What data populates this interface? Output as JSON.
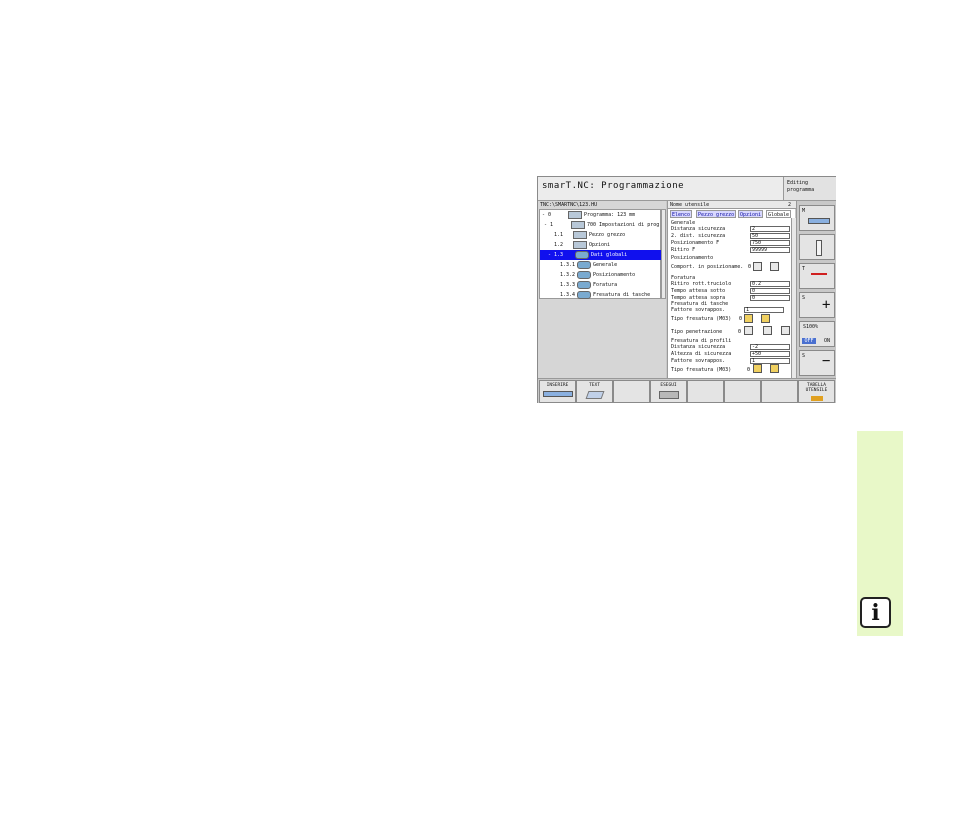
{
  "header": {
    "title": "smarT.NC: Programmazione",
    "mode": [
      "Editing",
      "programma"
    ]
  },
  "tree": {
    "path": "TNC:\\SMARTNC\\123.HU",
    "items": [
      {
        "num": "- 0",
        "label": "Programma: 123 mm",
        "selected": false
      },
      {
        "num": "- 1",
        "label": "700 Impostazioni di prog",
        "selected": false
      },
      {
        "num": "1.1",
        "label": "Pezzo grezzo",
        "selected": false
      },
      {
        "num": "1.2",
        "label": "Opzioni",
        "selected": false
      },
      {
        "num": "- 1.3",
        "label": "Dati globali",
        "selected": true
      },
      {
        "num": "1.3.1",
        "label": "Generale",
        "selected": false
      },
      {
        "num": "1.3.2",
        "label": "Posizionamento",
        "selected": false
      },
      {
        "num": "1.3.3",
        "label": "Foratura",
        "selected": false
      },
      {
        "num": "1.3.4",
        "label": "Fresatura di tasche",
        "selected": false
      }
    ]
  },
  "form": {
    "header_left": "Nome utensile",
    "header_right": "2",
    "tabs": [
      "Elenco",
      "Pezzo grezzo",
      "Opzioni",
      "Globale"
    ],
    "rows": [
      {
        "label": "Generale",
        "value": null
      },
      {
        "label": "Distanza sicurezza",
        "value": "2"
      },
      {
        "label": "2. dist. sicurezza",
        "value": "50"
      },
      {
        "label": "Posizionamento F",
        "value": "750"
      },
      {
        "label": "Ritiro F",
        "value": "99999"
      },
      {
        "label": "Posizionamento",
        "value": null
      },
      {
        "label": "Comport. in posizioname.",
        "value": null,
        "option": "0"
      },
      {
        "label": "Foratura",
        "value": null
      },
      {
        "label": "Ritiro rott.truciolo",
        "value": "0.2"
      },
      {
        "label": "Tempo attesa sotto",
        "value": "0"
      },
      {
        "label": "Tempo attesa sopra",
        "value": "0"
      },
      {
        "label": "Fresatura di tasche",
        "value": null
      },
      {
        "label": "Fattore sovrappos.",
        "value": "1"
      },
      {
        "label": "Tipo fresatura (M03)",
        "value": null,
        "option": "0"
      },
      {
        "label": "Tipo penetrazione",
        "value": null,
        "option": "0"
      },
      {
        "label": "Fresatura di profili",
        "value": null
      },
      {
        "label": "Distanza sicurezza",
        "value": "-2"
      },
      {
        "label": "Altezza di sicurezza",
        "value": "+50"
      },
      {
        "label": "Fattore sovrappos.",
        "value": "1"
      },
      {
        "label": "Tipo fresatura (M03)",
        "value": null,
        "option": "0"
      }
    ]
  },
  "right_keys": [
    {
      "label": "M"
    },
    {
      "label": ""
    },
    {
      "label": "T"
    },
    {
      "label": "S"
    },
    {
      "label": "S100%",
      "sub_left": "OFF",
      "sub_right": "ON"
    },
    {
      "label": "S"
    }
  ],
  "bottom_keys": [
    {
      "label": "INSERIRE"
    },
    {
      "label": "TEXT"
    },
    {
      "label": ""
    },
    {
      "label": "ESEGUI"
    },
    {
      "label": ""
    },
    {
      "label": ""
    },
    {
      "label": ""
    },
    {
      "label": "TABELLA UTENSILE"
    }
  ],
  "info_tab": {
    "icon": "info-icon",
    "char": "i",
    "color": "#e8f8c8"
  }
}
